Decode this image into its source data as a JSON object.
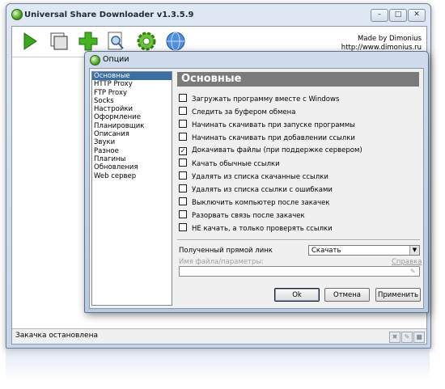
{
  "app": {
    "title": "Universal Share Downloader v1.3.5.9",
    "made_by_line1": "Made by Dimonius",
    "made_by_line2": "http://www.dimonius.ru",
    "window_buttons": [
      "minimize-icon",
      "maximize-icon",
      "close-icon"
    ],
    "toolbar_icons": [
      "play-icon",
      "windows-icon",
      "add-icon",
      "document-search-icon",
      "gear-icon",
      "globe-icon"
    ],
    "status_text": "Закачка остановлена",
    "status_icons": [
      "tools-icon",
      "clean-icon",
      "stop-icon"
    ]
  },
  "dialog": {
    "title": "Опции",
    "nav_items": [
      "Основные",
      "HTTP Proxy",
      "FTP Proxy",
      "Socks",
      "Настройки",
      "Оформление",
      "Планировщик",
      "Описания",
      "Звуки",
      "Разное",
      "Плагины",
      "Обновления",
      "Web сервер"
    ],
    "selected_nav": "Основные",
    "panel_title": "Основные",
    "options": [
      {
        "label": "Загружать программу вместе с Windows",
        "checked": false
      },
      {
        "label": "Следить за буфером обмена",
        "checked": false
      },
      {
        "label": "Начинать скачивать при запуске программы",
        "checked": false
      },
      {
        "label": "Начинать скачивать при добавлении ссылки",
        "checked": false
      },
      {
        "label": "Докачивать файлы (при поддержке сервером)",
        "checked": true
      },
      {
        "label": "Качать обычные ссылки",
        "checked": false
      },
      {
        "label": "Удалять из списка скачанные ссылки",
        "checked": false
      },
      {
        "label": "Удалять из списка ссылки с ошибками",
        "checked": false
      },
      {
        "label": "Выключить компьютер после закачек",
        "checked": false
      },
      {
        "label": "Разорвать связь после закачек",
        "checked": false
      },
      {
        "label": "НЕ качать, а только проверять ссылки",
        "checked": false
      }
    ],
    "direct_link_label": "Полученный прямой линк",
    "direct_link_value": "Скачать",
    "filename_label": "Имя файла/параметры:",
    "help_link": "Справка",
    "filename_value": "",
    "ok_label": "Ok",
    "cancel_label": "Отмена",
    "apply_label": "Применить"
  }
}
